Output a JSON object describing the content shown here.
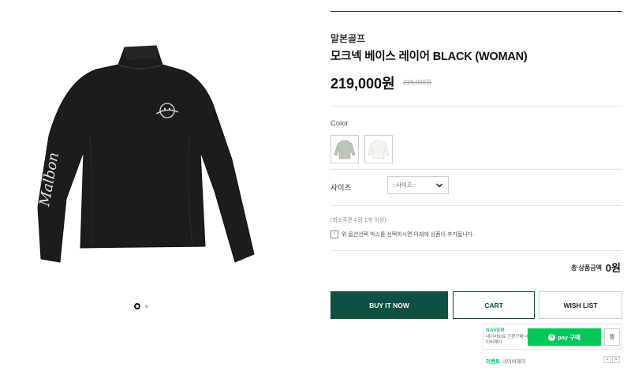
{
  "product": {
    "brand": "말본골프",
    "name": "모크넥 베이스 레이어 BLACK (WOMAN)",
    "price": "219,000원",
    "original_price": "219,000원"
  },
  "gallery": {
    "image_icon": "black-mockneck-shirt-image",
    "sleeve_text": "Malbon",
    "dots_total": 2,
    "dots_active_index": 0
  },
  "options": {
    "color_label": "Color",
    "swatches": [
      "light-green-shirt-swatch",
      "white-shirt-swatch"
    ],
    "size_label": "사이즈",
    "size_select_value": "::사이즈::"
  },
  "notes": {
    "min_order": "(최소주문수량 1개 이상)",
    "notice_icon_text": "!",
    "notice_text": "위 옵션선택 박스를 선택하시면 아래에 상품이 추가됩니다."
  },
  "total": {
    "label": "총 상품금액",
    "value": "0원"
  },
  "buttons": {
    "buy_now": "BUY IT NOW",
    "cart": "CART",
    "wishlist": "WISH LIST"
  },
  "npay": {
    "logo": "NAVER",
    "desc": "네이버ID로 간편구매 네이버페이",
    "pay_mark": "N",
    "pay_label": "pay 구매",
    "wish_label": "찜",
    "event_label": "이벤트",
    "event_text": "네이버페이",
    "prev": "<",
    "next": ">"
  },
  "colors": {
    "brand_green": "#0e5142",
    "naver_green": "#03c75a",
    "shirt": "#1c1c1c"
  }
}
